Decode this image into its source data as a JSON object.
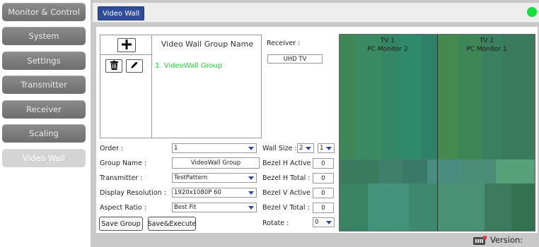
{
  "sidebar": {
    "items": [
      {
        "label": "Monitor & Control",
        "active": false
      },
      {
        "label": "System",
        "active": false
      },
      {
        "label": "Settings",
        "active": false
      },
      {
        "label": "Transmitter",
        "active": false
      },
      {
        "label": "Receiver",
        "active": false
      },
      {
        "label": "Scaling",
        "active": false
      },
      {
        "label": "Video Wall",
        "active": true
      }
    ]
  },
  "header": {
    "tab_label": "Video Wall",
    "status_color": "#14e03a"
  },
  "group_list": {
    "header": "Video Wall Group Name",
    "add_icon": "plus-icon",
    "delete_icon": "trash-icon",
    "edit_icon": "pencil-icon",
    "items": [
      "1. VideoWall Group"
    ],
    "item_color": "#2ecc40"
  },
  "receiver": {
    "label": "Receiver :",
    "value": "UHD TV"
  },
  "form": {
    "order": {
      "label": "Order :",
      "value": "1"
    },
    "group_name": {
      "label": "Group Name :",
      "value": "VideoWall Group"
    },
    "transmitter": {
      "label": "Transmitter :",
      "value": "TestPattern"
    },
    "display_resolution": {
      "label": "Display Resolution :",
      "value": "1920x1080P 60"
    },
    "aspect_ratio": {
      "label": "Aspect Ratio :",
      "value": "Best Fit"
    },
    "save_group": "Save Group",
    "save_execute": "Save&Execute"
  },
  "wall": {
    "wall_size_label": "Wall Size :",
    "wall_size_cols": "2",
    "wall_size_rows": "1",
    "bezel_h_active_label": "Bezel H Active :",
    "bezel_h_active": "0",
    "bezel_h_total_label": "Bezel H Total :",
    "bezel_h_total": "0",
    "bezel_v_active_label": "Bezel V Active :",
    "bezel_v_active": "0",
    "bezel_v_total_label": "Bezel V Total :",
    "bezel_v_total": "0",
    "rotate_label": "Rotate :",
    "rotate": "0"
  },
  "preview": {
    "tv1_title": "TV 1",
    "tv1_name": "PC Monitor 2",
    "tv2_title": "TV 2",
    "tv2_name": "PC Monitor 1"
  },
  "footer": {
    "version_label": "Version:",
    "icon": "keyboard-icon"
  }
}
